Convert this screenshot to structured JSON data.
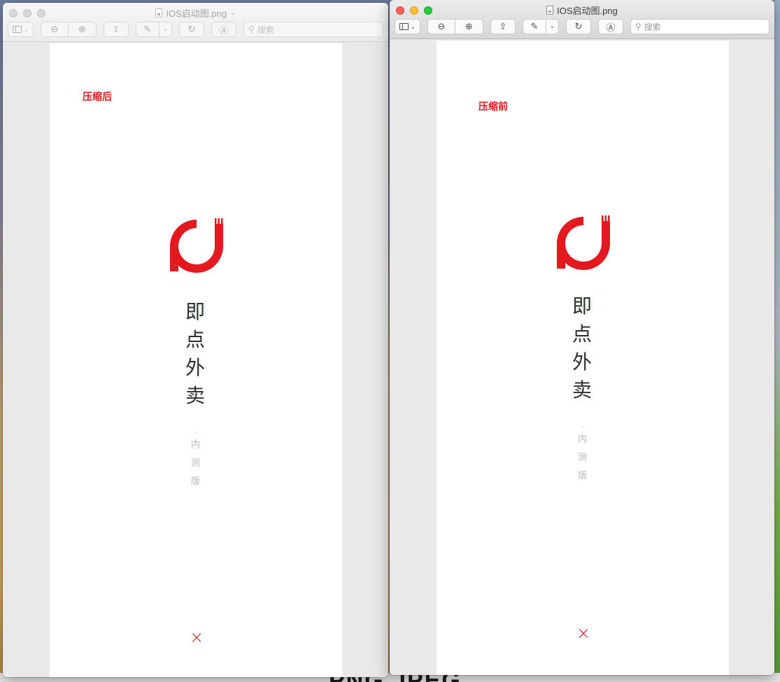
{
  "desktop": {
    "bottom_text": "PNG  JPEG"
  },
  "windows": [
    {
      "title": "IOS启动图.png",
      "active": false,
      "search_placeholder": "搜索",
      "label": "压缩后",
      "app_name_chars": [
        "即",
        "点",
        "外",
        "卖"
      ],
      "sub_dash": "-",
      "sub_chars": [
        "内",
        "测",
        "版"
      ],
      "footer_mark": "×"
    },
    {
      "title": "IOS启动图.png",
      "active": true,
      "search_placeholder": "搜索",
      "label": "压缩前",
      "app_name_chars": [
        "即",
        "点",
        "外",
        "卖"
      ],
      "sub_dash": "-",
      "sub_chars": [
        "内",
        "测",
        "版"
      ],
      "footer_mark": "×"
    }
  ],
  "icons": {
    "sidebar": "sidebar-icon",
    "zoom_out": "zoom-out-icon",
    "zoom_in": "zoom-in-icon",
    "share": "share-icon",
    "markup": "pen-icon",
    "rotate": "rotate-icon",
    "annotate": "markup-circle-icon",
    "search": "search-icon"
  },
  "colors": {
    "brand_red": "#e3191f",
    "text_dark": "#2e2e2e",
    "text_muted": "#b8b8b8"
  }
}
